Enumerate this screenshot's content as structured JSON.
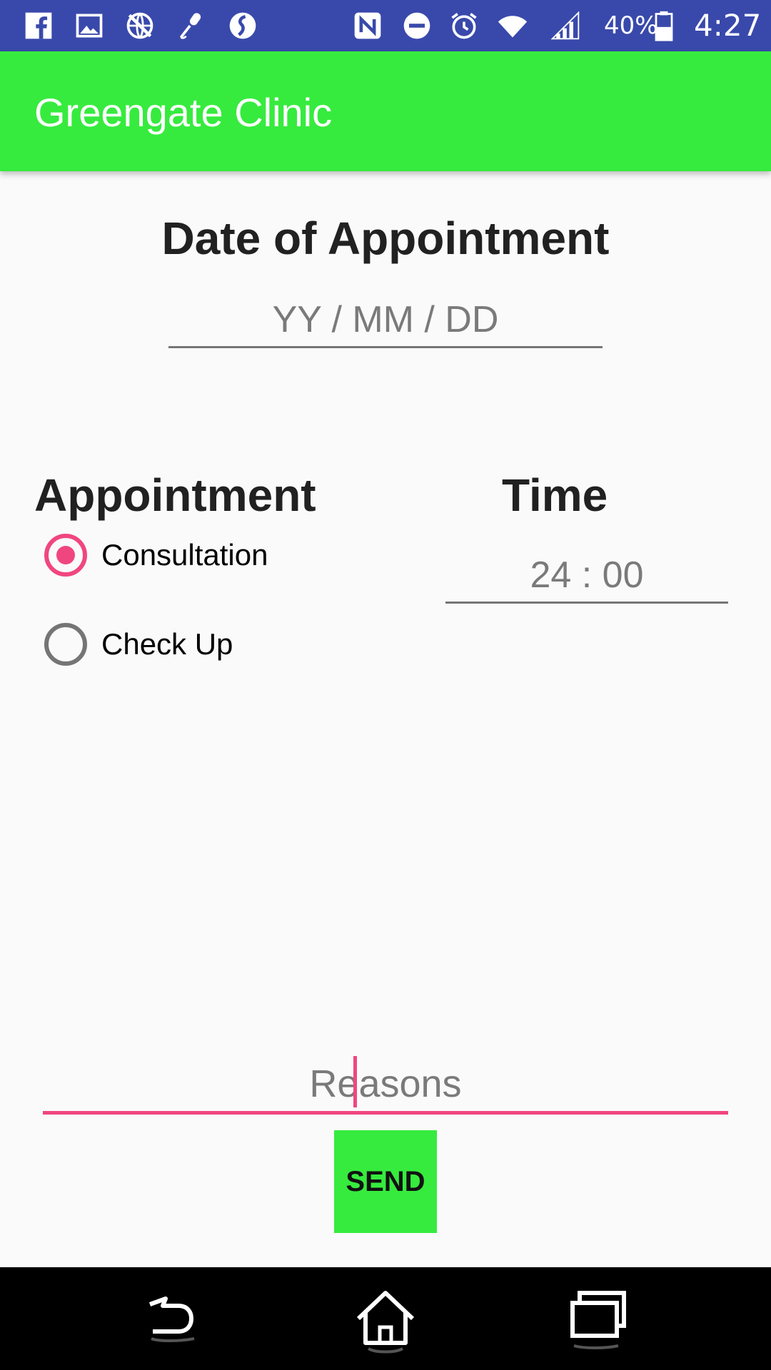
{
  "status_bar": {
    "icons": [
      "facebook-icon",
      "gallery-icon",
      "no-network-icon",
      "microphone-icon",
      "sync-icon",
      "nfc-icon",
      "do-not-disturb-icon",
      "alarm-icon",
      "wifi-icon",
      "signal-icon",
      "battery-icon"
    ],
    "battery": "40%",
    "time": "4:27"
  },
  "app_bar": {
    "title": "Greengate Clinic",
    "color": "#36eb3e"
  },
  "date_section": {
    "heading": "Date of Appointment",
    "placeholder": "YY / MM / DD"
  },
  "appointment": {
    "heading": "Appointment",
    "options": [
      {
        "label": "Consultation",
        "checked": true
      },
      {
        "label": "Check Up",
        "checked": false
      }
    ]
  },
  "time_section": {
    "heading": "Time",
    "placeholder": "24 : 00"
  },
  "reasons": {
    "placeholder": "Reasons",
    "accent": "#f0467f"
  },
  "send_button": {
    "label": "SEND"
  },
  "nav_bar": {
    "icons": [
      "back-icon",
      "home-icon",
      "recents-icon"
    ]
  }
}
